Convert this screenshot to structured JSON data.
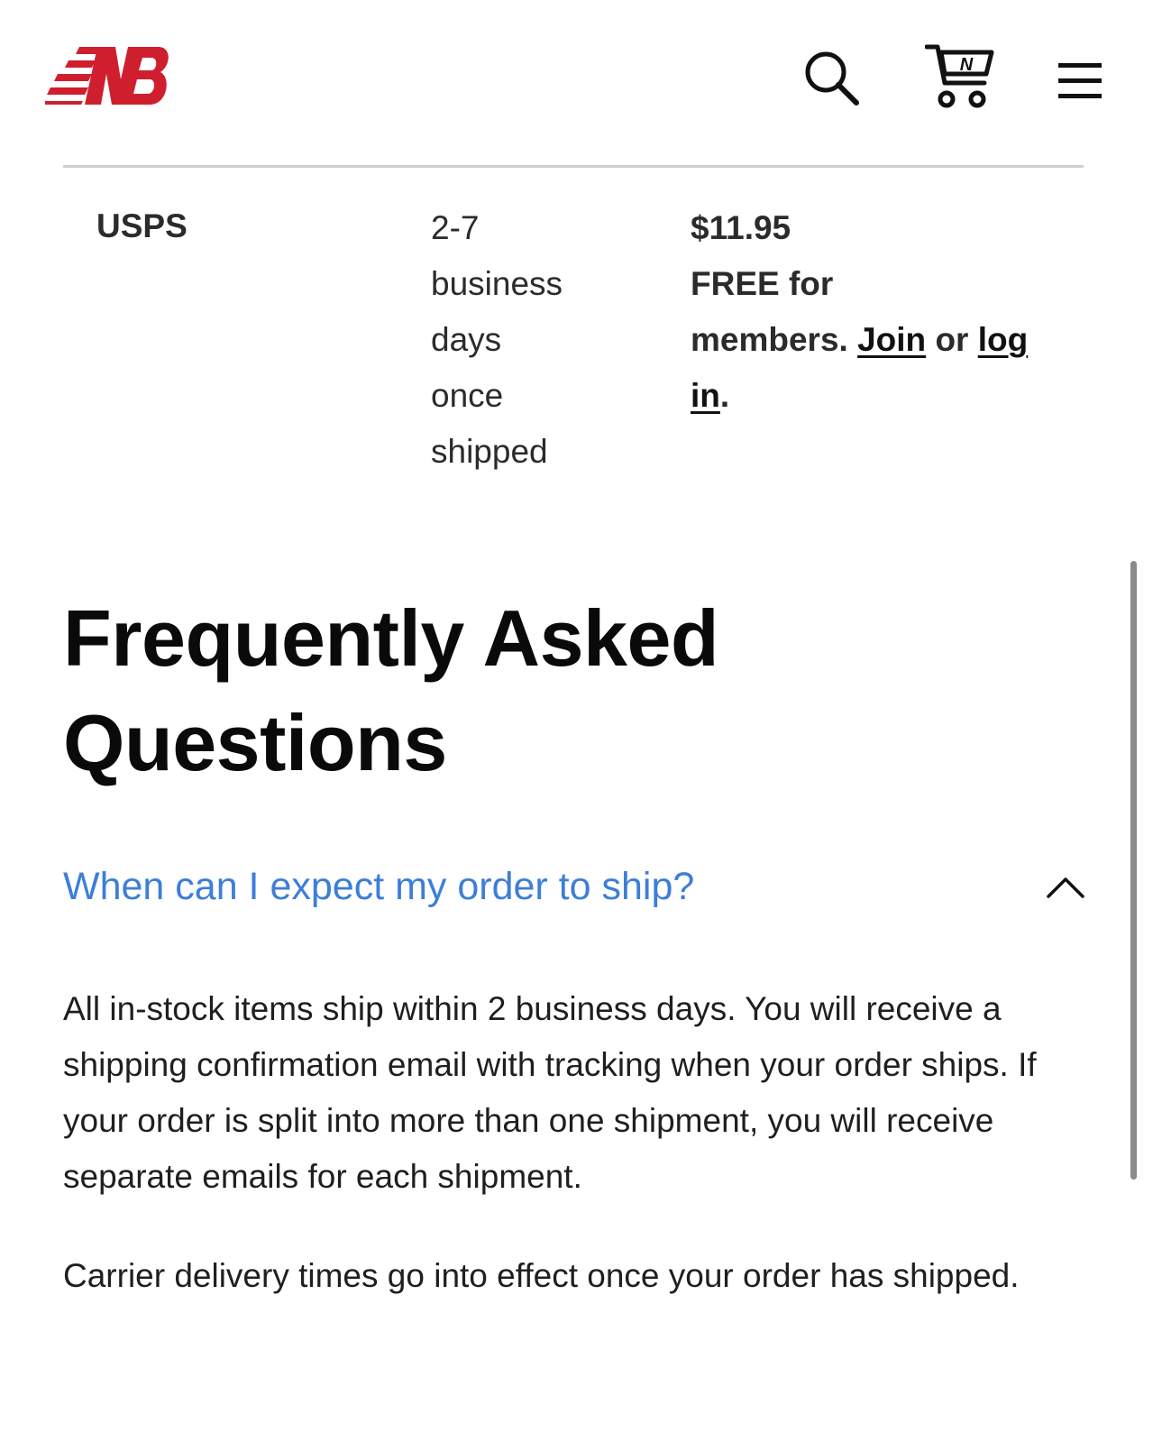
{
  "header": {
    "logo_alt": "New Balance",
    "brand_color": "#cf1f2e",
    "icons": [
      "search-icon",
      "cart-icon",
      "menu-icon"
    ],
    "cart_badge_letter": "N"
  },
  "shipping": {
    "carrier": "USPS",
    "eta_lines": [
      "2-7",
      "business",
      "days",
      "once",
      "shipped"
    ],
    "price": "$11.95",
    "free_text_1": "FREE for",
    "free_text_2": "members.",
    "join_label": "Join",
    "or_label": "or",
    "login_label_1": "log",
    "login_label_2": "in",
    "period": "."
  },
  "faq": {
    "title_line_1": "Frequently Asked",
    "title_line_2": "Questions",
    "question": "When can I expect my order to ship?",
    "question_color": "#3d7ed8",
    "expanded": true,
    "answer_p1": "All in-stock items ship within 2 business days. You will receive a shipping confirmation email with tracking when your order ships. If your order is split into more than one shipment, you will receive separate emails for each shipment.",
    "answer_p2": "Carrier delivery times go into effect once your order has shipped."
  }
}
